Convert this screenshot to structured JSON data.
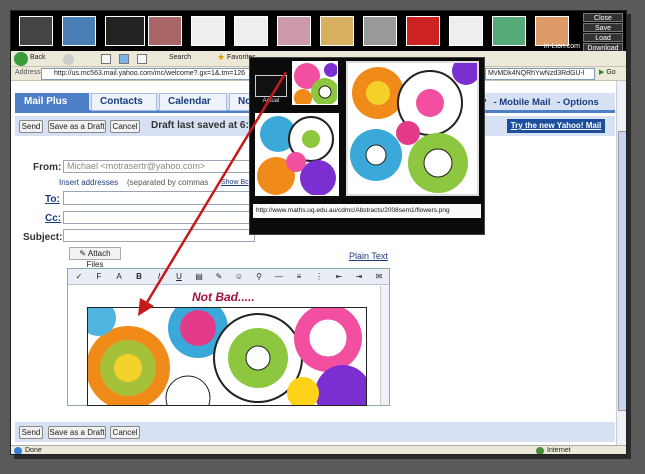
{
  "thumb_strip": {
    "controls": [
      "Close",
      "Save",
      "Load",
      "Download"
    ],
    "site_label": "in-Lion.com",
    "thumbs": [
      {
        "name": "lion",
        "color": "#444"
      },
      {
        "name": "globe",
        "color": "#4a7fb5"
      },
      {
        "name": "dark",
        "color": "#222"
      },
      {
        "name": "people",
        "color": "#a66"
      },
      {
        "name": "blank",
        "color": "#eee"
      },
      {
        "name": "blank",
        "color": "#eee"
      },
      {
        "name": "flowers",
        "color": "#c9a"
      },
      {
        "name": "woman",
        "color": "#d8b060"
      },
      {
        "name": "tesla",
        "color": "#999"
      },
      {
        "name": "car",
        "color": "#c22"
      },
      {
        "name": "blank",
        "color": "#eee"
      },
      {
        "name": "bird",
        "color": "#5a7"
      },
      {
        "name": "tiger",
        "color": "#d96"
      }
    ]
  },
  "ie": {
    "back_label": "Back",
    "search_label": "Search",
    "favorites_label": "Favorites",
    "address_label": "Address",
    "address_url": "http://us.mc563.mail.yahoo.com/mc/welcome?.gx=1&.tm=126",
    "address_tail": "MvMDk4NQRhYwNzd3RdGU-l",
    "go_label": "Go",
    "status_done": "Done",
    "status_zone": "Internet"
  },
  "mail": {
    "tabs": [
      "Mail Plus",
      "Contacts",
      "Calendar",
      "Not"
    ],
    "top_links": [
      "?",
      "- Mobile Mail",
      "- Options"
    ],
    "send_label": "Send",
    "save_draft_label": "Save as a Draft",
    "cancel_label": "Cancel",
    "draft_status": "Draft last saved at 6:0",
    "try_yahoo": "Try the new Yahoo! Mail",
    "from_label": "From:",
    "from_value": "Michael <motrasertr@yahoo.com>",
    "insert_addresses": "Insert addresses",
    "insert_note": "(separated by commas",
    "show_bcc": "Show Bc",
    "to_label": "To:",
    "cc_label": "Cc:",
    "subject_label": "Subject:",
    "attach_label": "Attach Files",
    "plain_text": "Plain Text",
    "editor_text": "Not Bad.....",
    "editor_tools": [
      "spell",
      "font",
      "color",
      "B",
      "I",
      "U",
      "files",
      "highlight",
      "emoji",
      "link",
      "hr",
      "list",
      "bullets",
      "outdent",
      "indent",
      "stationery"
    ]
  },
  "popup": {
    "actual_label": "Actual",
    "image_url": "http://www.maths.uq.edu.au/cdmc/Abstracts/2008sem1/flowers.png"
  },
  "colors": {
    "yahoo_blue": "#4d7fc6",
    "dark_blue": "#1d4e9b",
    "annotation_red": "#c41a1a"
  }
}
